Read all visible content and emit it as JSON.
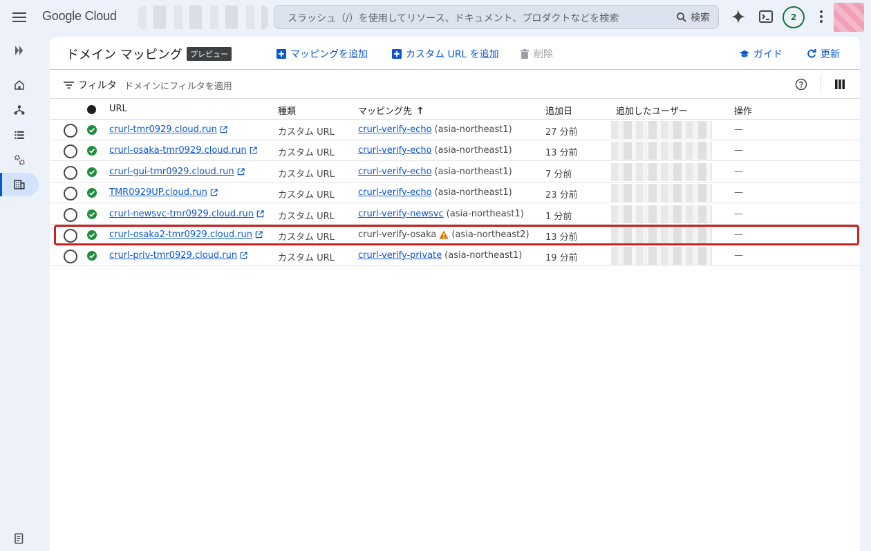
{
  "topbar": {
    "logo": "Google Cloud",
    "search_placeholder": "スラッシュ（/）を使用してリソース、ドキュメント、プロダクトなどを検索",
    "search_button": "検索",
    "notification_count": "2"
  },
  "page": {
    "title": "ドメイン マッピング",
    "badge": "プレビュー",
    "actions": {
      "add_mapping": "マッピングを追加",
      "add_custom_url": "カスタム URL を追加",
      "delete": "削除",
      "guide": "ガイド",
      "refresh": "更新"
    }
  },
  "filter": {
    "label": "フィルタ",
    "placeholder": "ドメインにフィルタを適用"
  },
  "table": {
    "headers": {
      "url": "URL",
      "type": "種類",
      "mapping": "マッピング先",
      "added": "追加日",
      "added_by": "追加したユーザー",
      "actions": "操作"
    },
    "sort_indicator": "↑",
    "rows": [
      {
        "url": "crurl-tmr0929.cloud.run",
        "type": "カスタム URL",
        "service": "crurl-verify-echo",
        "region": "(asia-northeast1)",
        "added": "27 分前",
        "ops": "—",
        "service_linked": true
      },
      {
        "url": "crurl-osaka-tmr0929.cloud.run",
        "type": "カスタム URL",
        "service": "crurl-verify-echo",
        "region": "(asia-northeast1)",
        "added": "13 分前",
        "ops": "—",
        "service_linked": true
      },
      {
        "url": "crurl-gui-tmr0929.cloud.run",
        "type": "カスタム URL",
        "service": "crurl-verify-echo",
        "region": "(asia-northeast1)",
        "added": "7 分前",
        "ops": "—",
        "service_linked": true
      },
      {
        "url": "TMR0929UP.cloud.run",
        "type": "カスタム URL",
        "service": "crurl-verify-echo",
        "region": "(asia-northeast1)",
        "added": "23 分前",
        "ops": "—",
        "service_linked": true
      },
      {
        "url": "crurl-newsvc-tmr0929.cloud.run",
        "type": "カスタム URL",
        "service": "crurl-verify-newsvc",
        "region": "(asia-northeast1)",
        "added": "1 分前",
        "ops": "—",
        "service_linked": true
      },
      {
        "url": "crurl-osaka2-tmr0929.cloud.run",
        "type": "カスタム URL",
        "service": "crurl-verify-osaka",
        "region": "(asia-northeast2)",
        "added": "13 分前",
        "ops": "—",
        "service_linked": false,
        "warning": true
      },
      {
        "url": "crurl-priv-tmr0929.cloud.run",
        "type": "カスタム URL",
        "service": "crurl-verify-private",
        "region": "(asia-northeast1)",
        "added": "19 分前",
        "ops": "—",
        "service_linked": true
      }
    ]
  },
  "colors": {
    "accent": "#0b57d0",
    "success": "#1e8e3e",
    "warning": "#e37400",
    "highlight": "#d01f1f"
  }
}
